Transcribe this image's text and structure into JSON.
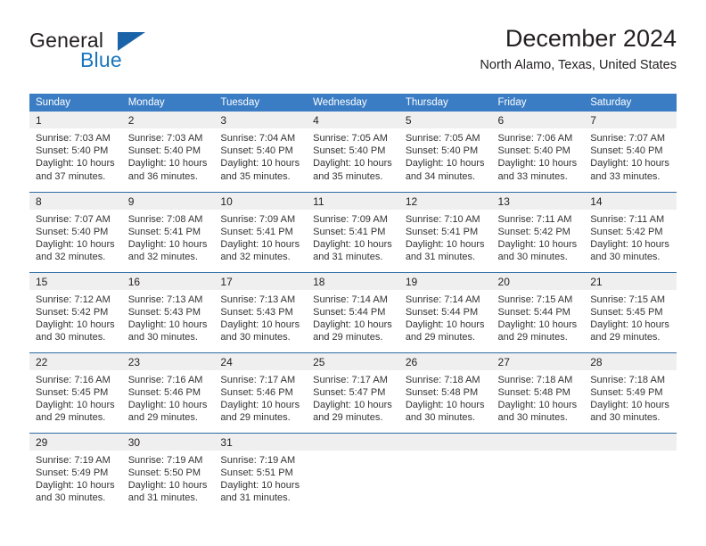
{
  "brand": {
    "name_top": "General",
    "name_bottom": "Blue",
    "accent_color": "#1b75bb",
    "triangle_color": "#1b63a8"
  },
  "header": {
    "title": "December 2024",
    "subtitle": "North Alamo, Texas, United States"
  },
  "theme": {
    "header_blue": "#3b7dc4",
    "row_divider_blue": "#2e6da4",
    "daynum_band": "#efefef",
    "text": "#231f20"
  },
  "calendar": {
    "weekdays": [
      "Sunday",
      "Monday",
      "Tuesday",
      "Wednesday",
      "Thursday",
      "Friday",
      "Saturday"
    ],
    "labels": {
      "sunrise": "Sunrise:",
      "sunset": "Sunset:",
      "daylight": "Daylight:"
    },
    "weeks": [
      [
        {
          "day": "1",
          "sunrise": "Sunrise: 7:03 AM",
          "sunset": "Sunset: 5:40 PM",
          "daylight1": "Daylight: 10 hours",
          "daylight2": "and 37 minutes."
        },
        {
          "day": "2",
          "sunrise": "Sunrise: 7:03 AM",
          "sunset": "Sunset: 5:40 PM",
          "daylight1": "Daylight: 10 hours",
          "daylight2": "and 36 minutes."
        },
        {
          "day": "3",
          "sunrise": "Sunrise: 7:04 AM",
          "sunset": "Sunset: 5:40 PM",
          "daylight1": "Daylight: 10 hours",
          "daylight2": "and 35 minutes."
        },
        {
          "day": "4",
          "sunrise": "Sunrise: 7:05 AM",
          "sunset": "Sunset: 5:40 PM",
          "daylight1": "Daylight: 10 hours",
          "daylight2": "and 35 minutes."
        },
        {
          "day": "5",
          "sunrise": "Sunrise: 7:05 AM",
          "sunset": "Sunset: 5:40 PM",
          "daylight1": "Daylight: 10 hours",
          "daylight2": "and 34 minutes."
        },
        {
          "day": "6",
          "sunrise": "Sunrise: 7:06 AM",
          "sunset": "Sunset: 5:40 PM",
          "daylight1": "Daylight: 10 hours",
          "daylight2": "and 33 minutes."
        },
        {
          "day": "7",
          "sunrise": "Sunrise: 7:07 AM",
          "sunset": "Sunset: 5:40 PM",
          "daylight1": "Daylight: 10 hours",
          "daylight2": "and 33 minutes."
        }
      ],
      [
        {
          "day": "8",
          "sunrise": "Sunrise: 7:07 AM",
          "sunset": "Sunset: 5:40 PM",
          "daylight1": "Daylight: 10 hours",
          "daylight2": "and 32 minutes."
        },
        {
          "day": "9",
          "sunrise": "Sunrise: 7:08 AM",
          "sunset": "Sunset: 5:41 PM",
          "daylight1": "Daylight: 10 hours",
          "daylight2": "and 32 minutes."
        },
        {
          "day": "10",
          "sunrise": "Sunrise: 7:09 AM",
          "sunset": "Sunset: 5:41 PM",
          "daylight1": "Daylight: 10 hours",
          "daylight2": "and 32 minutes."
        },
        {
          "day": "11",
          "sunrise": "Sunrise: 7:09 AM",
          "sunset": "Sunset: 5:41 PM",
          "daylight1": "Daylight: 10 hours",
          "daylight2": "and 31 minutes."
        },
        {
          "day": "12",
          "sunrise": "Sunrise: 7:10 AM",
          "sunset": "Sunset: 5:41 PM",
          "daylight1": "Daylight: 10 hours",
          "daylight2": "and 31 minutes."
        },
        {
          "day": "13",
          "sunrise": "Sunrise: 7:11 AM",
          "sunset": "Sunset: 5:42 PM",
          "daylight1": "Daylight: 10 hours",
          "daylight2": "and 30 minutes."
        },
        {
          "day": "14",
          "sunrise": "Sunrise: 7:11 AM",
          "sunset": "Sunset: 5:42 PM",
          "daylight1": "Daylight: 10 hours",
          "daylight2": "and 30 minutes."
        }
      ],
      [
        {
          "day": "15",
          "sunrise": "Sunrise: 7:12 AM",
          "sunset": "Sunset: 5:42 PM",
          "daylight1": "Daylight: 10 hours",
          "daylight2": "and 30 minutes."
        },
        {
          "day": "16",
          "sunrise": "Sunrise: 7:13 AM",
          "sunset": "Sunset: 5:43 PM",
          "daylight1": "Daylight: 10 hours",
          "daylight2": "and 30 minutes."
        },
        {
          "day": "17",
          "sunrise": "Sunrise: 7:13 AM",
          "sunset": "Sunset: 5:43 PM",
          "daylight1": "Daylight: 10 hours",
          "daylight2": "and 30 minutes."
        },
        {
          "day": "18",
          "sunrise": "Sunrise: 7:14 AM",
          "sunset": "Sunset: 5:44 PM",
          "daylight1": "Daylight: 10 hours",
          "daylight2": "and 29 minutes."
        },
        {
          "day": "19",
          "sunrise": "Sunrise: 7:14 AM",
          "sunset": "Sunset: 5:44 PM",
          "daylight1": "Daylight: 10 hours",
          "daylight2": "and 29 minutes."
        },
        {
          "day": "20",
          "sunrise": "Sunrise: 7:15 AM",
          "sunset": "Sunset: 5:44 PM",
          "daylight1": "Daylight: 10 hours",
          "daylight2": "and 29 minutes."
        },
        {
          "day": "21",
          "sunrise": "Sunrise: 7:15 AM",
          "sunset": "Sunset: 5:45 PM",
          "daylight1": "Daylight: 10 hours",
          "daylight2": "and 29 minutes."
        }
      ],
      [
        {
          "day": "22",
          "sunrise": "Sunrise: 7:16 AM",
          "sunset": "Sunset: 5:45 PM",
          "daylight1": "Daylight: 10 hours",
          "daylight2": "and 29 minutes."
        },
        {
          "day": "23",
          "sunrise": "Sunrise: 7:16 AM",
          "sunset": "Sunset: 5:46 PM",
          "daylight1": "Daylight: 10 hours",
          "daylight2": "and 29 minutes."
        },
        {
          "day": "24",
          "sunrise": "Sunrise: 7:17 AM",
          "sunset": "Sunset: 5:46 PM",
          "daylight1": "Daylight: 10 hours",
          "daylight2": "and 29 minutes."
        },
        {
          "day": "25",
          "sunrise": "Sunrise: 7:17 AM",
          "sunset": "Sunset: 5:47 PM",
          "daylight1": "Daylight: 10 hours",
          "daylight2": "and 29 minutes."
        },
        {
          "day": "26",
          "sunrise": "Sunrise: 7:18 AM",
          "sunset": "Sunset: 5:48 PM",
          "daylight1": "Daylight: 10 hours",
          "daylight2": "and 30 minutes."
        },
        {
          "day": "27",
          "sunrise": "Sunrise: 7:18 AM",
          "sunset": "Sunset: 5:48 PM",
          "daylight1": "Daylight: 10 hours",
          "daylight2": "and 30 minutes."
        },
        {
          "day": "28",
          "sunrise": "Sunrise: 7:18 AM",
          "sunset": "Sunset: 5:49 PM",
          "daylight1": "Daylight: 10 hours",
          "daylight2": "and 30 minutes."
        }
      ],
      [
        {
          "day": "29",
          "sunrise": "Sunrise: 7:19 AM",
          "sunset": "Sunset: 5:49 PM",
          "daylight1": "Daylight: 10 hours",
          "daylight2": "and 30 minutes."
        },
        {
          "day": "30",
          "sunrise": "Sunrise: 7:19 AM",
          "sunset": "Sunset: 5:50 PM",
          "daylight1": "Daylight: 10 hours",
          "daylight2": "and 31 minutes."
        },
        {
          "day": "31",
          "sunrise": "Sunrise: 7:19 AM",
          "sunset": "Sunset: 5:51 PM",
          "daylight1": "Daylight: 10 hours",
          "daylight2": "and 31 minutes."
        },
        {
          "day": "",
          "sunrise": "",
          "sunset": "",
          "daylight1": "",
          "daylight2": ""
        },
        {
          "day": "",
          "sunrise": "",
          "sunset": "",
          "daylight1": "",
          "daylight2": ""
        },
        {
          "day": "",
          "sunrise": "",
          "sunset": "",
          "daylight1": "",
          "daylight2": ""
        },
        {
          "day": "",
          "sunrise": "",
          "sunset": "",
          "daylight1": "",
          "daylight2": ""
        }
      ]
    ]
  }
}
